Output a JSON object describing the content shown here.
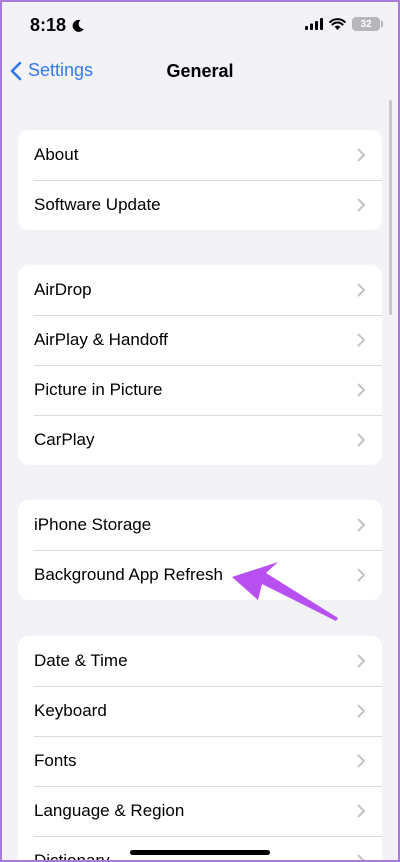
{
  "status_bar": {
    "time": "8:18",
    "battery": "32"
  },
  "nav": {
    "back_label": "Settings",
    "title": "General"
  },
  "groups": [
    {
      "items": [
        {
          "label": "About"
        },
        {
          "label": "Software Update"
        }
      ]
    },
    {
      "items": [
        {
          "label": "AirDrop"
        },
        {
          "label": "AirPlay & Handoff"
        },
        {
          "label": "Picture in Picture"
        },
        {
          "label": "CarPlay"
        }
      ]
    },
    {
      "items": [
        {
          "label": "iPhone Storage"
        },
        {
          "label": "Background App Refresh"
        }
      ]
    },
    {
      "items": [
        {
          "label": "Date & Time"
        },
        {
          "label": "Keyboard"
        },
        {
          "label": "Fonts"
        },
        {
          "label": "Language & Region"
        },
        {
          "label": "Dictionary"
        }
      ]
    }
  ],
  "colors": {
    "accent": "#3478f6",
    "background": "#f2f2f7",
    "annotation_arrow": "#b84ff0"
  },
  "icons": {
    "back": "chevron-left-icon",
    "row": "chevron-right-icon",
    "moon": "moon-icon",
    "signal": "cellular-signal-icon",
    "wifi": "wifi-icon",
    "battery": "battery-icon"
  }
}
